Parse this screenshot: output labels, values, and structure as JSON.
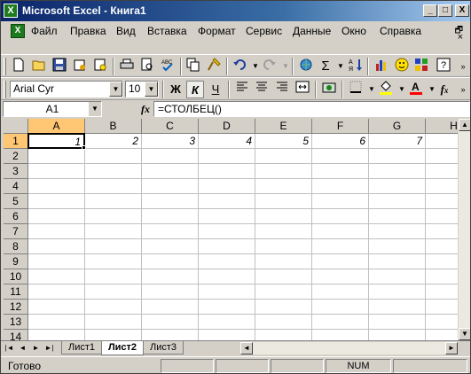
{
  "window": {
    "title": "Microsoft Excel - Книга1",
    "app_icon_letter": "X",
    "buttons": {
      "minimize": "_",
      "maximize": "□",
      "close": "X"
    }
  },
  "menubar": {
    "items": [
      "Файл",
      "Правка",
      "Вид",
      "Вставка",
      "Формат",
      "Сервис",
      "Данные",
      "Окно",
      "Справка"
    ],
    "doc_controls": {
      "restore": "🗗",
      "close": "×"
    }
  },
  "toolbar_standard": {
    "icons": [
      "new-icon",
      "open-icon",
      "save-icon",
      "permission-icon",
      "email-icon",
      "print-icon",
      "print-preview-icon",
      "spelling-icon",
      "copy-icon",
      "format-painter-icon",
      "undo-icon",
      "redo-icon",
      "hyperlink-icon",
      "autosum-icon",
      "sort-icon",
      "chart-wizard-icon",
      "smiley-icon",
      "drawing-icon",
      "help-icon"
    ],
    "autosum_label": "Σ"
  },
  "toolbar_format": {
    "font": "Arial Cyr",
    "size": "10",
    "bold": "Ж",
    "italic": "К",
    "underline": "Ч",
    "fx_label": "f",
    "fx_sub": "x"
  },
  "formula_bar": {
    "name_box": "A1",
    "fx": "fx",
    "formula": "=СТОЛБЕЦ()"
  },
  "grid": {
    "columns": [
      "A",
      "B",
      "C",
      "D",
      "E",
      "F",
      "G",
      "H"
    ],
    "rows": [
      "1",
      "2",
      "3",
      "4",
      "5",
      "6",
      "7",
      "8",
      "9",
      "10",
      "11",
      "12",
      "13",
      "14"
    ],
    "row1_values": [
      "1",
      "2",
      "3",
      "4",
      "5",
      "6",
      "7"
    ],
    "selected_cell": "A1"
  },
  "sheets": {
    "tabs": [
      "Лист1",
      "Лист2",
      "Лист3"
    ],
    "active": "Лист2"
  },
  "statusbar": {
    "text": "Готово",
    "num": "NUM"
  }
}
